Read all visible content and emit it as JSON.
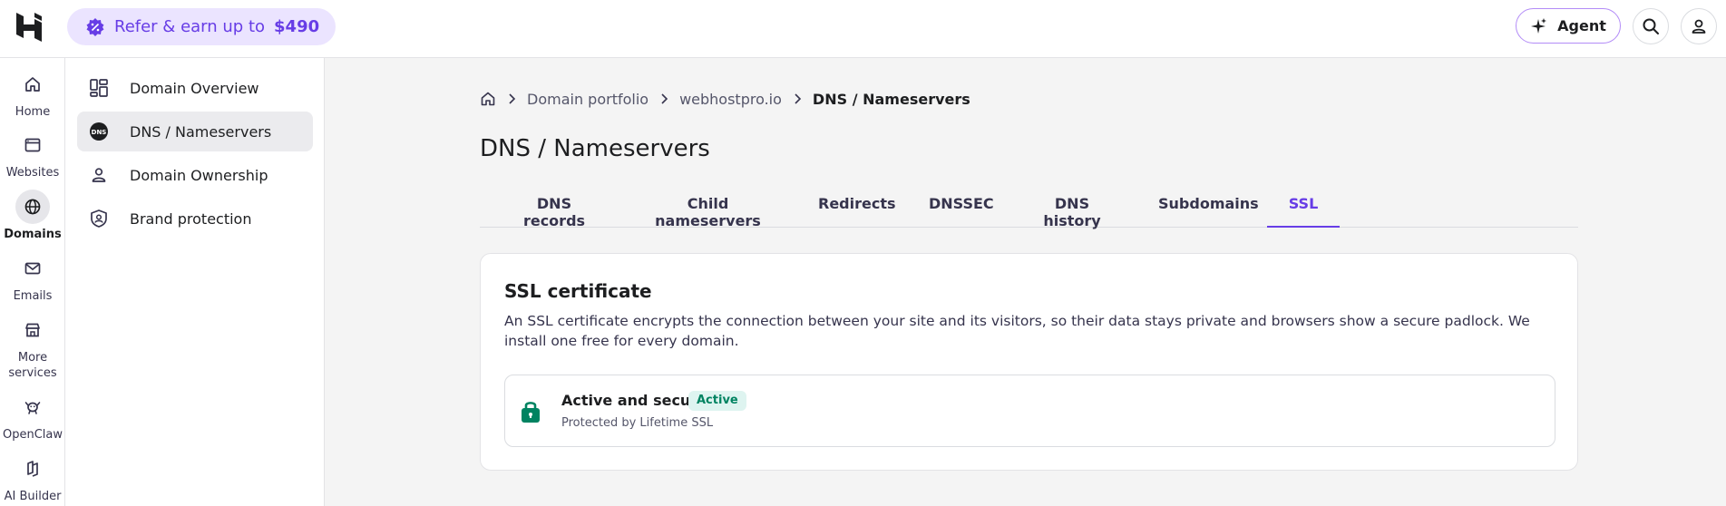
{
  "header": {
    "refer": {
      "text": "Refer & earn up to",
      "amount": "$490"
    },
    "agent_label": "Agent"
  },
  "rail": {
    "items": [
      {
        "label": "Home",
        "icon": "home-icon"
      },
      {
        "label": "Websites",
        "icon": "browser-icon"
      },
      {
        "label": "Domains",
        "icon": "globe-icon",
        "active": true
      },
      {
        "label": "Emails",
        "icon": "mail-icon"
      },
      {
        "label": "More services",
        "icon": "store-icon"
      },
      {
        "label": "OpenClaw",
        "icon": "claw-icon"
      },
      {
        "label": "AI Builder",
        "icon": "ai-builder-icon"
      }
    ]
  },
  "sidenav": {
    "items": [
      {
        "label": "Domain Overview",
        "icon": "grid-icon"
      },
      {
        "label": "DNS / Nameservers",
        "icon": "dns-icon",
        "active": true
      },
      {
        "label": "Domain Ownership",
        "icon": "person-icon"
      },
      {
        "label": "Brand protection",
        "icon": "shield-icon"
      }
    ],
    "dns_icon_text": "DNS"
  },
  "breadcrumb": {
    "items": [
      "Domain portfolio",
      "webhostpro.io"
    ],
    "current": "DNS / Nameservers"
  },
  "page": {
    "title": "DNS / Nameservers",
    "tabs": [
      "DNS records",
      "Child nameservers",
      "Redirects",
      "DNSSEC",
      "DNS history",
      "Subdomains",
      "SSL"
    ],
    "active_tab": "SSL"
  },
  "ssl_card": {
    "title": "SSL certificate",
    "description": "An SSL certificate encrypts the connection between your site and its visitors, so their data stays private and browsers show a secure padlock. We install one free for every domain.",
    "status_title": "Active and secure",
    "badge": "Active",
    "subtitle": "Protected by Lifetime SSL"
  },
  "colors": {
    "accent": "#673de6",
    "success": "#008361",
    "success_bg": "#def4f0",
    "refer_bg": "#ebe4ff"
  }
}
